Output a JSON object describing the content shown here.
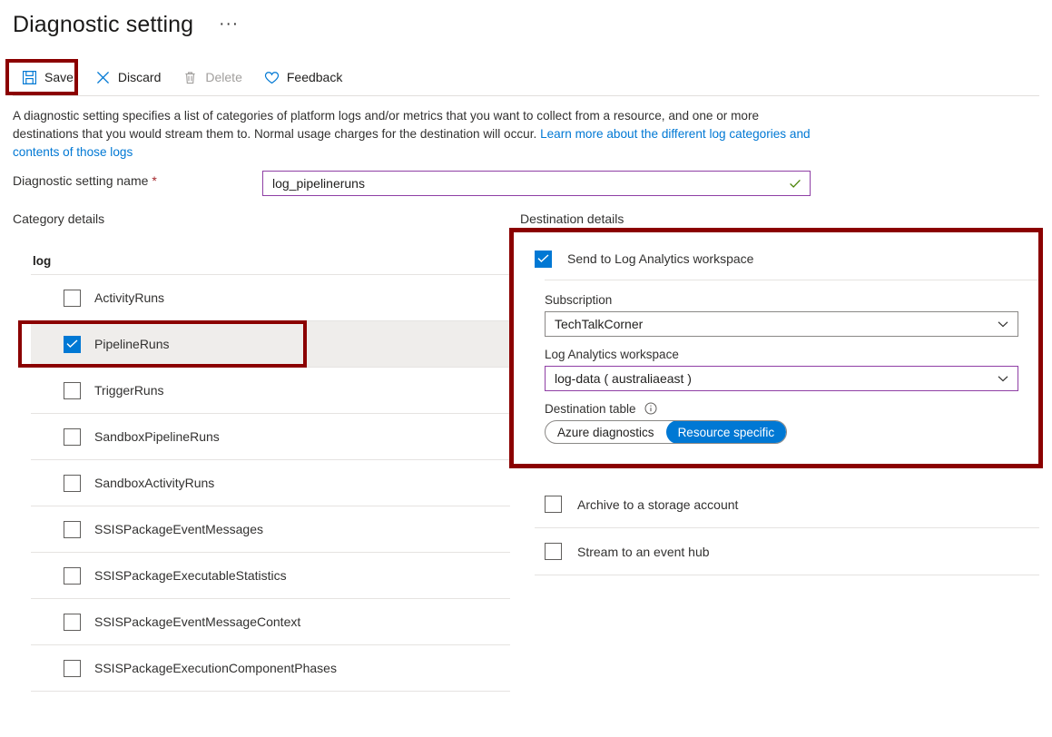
{
  "header": {
    "title": "Diagnostic setting",
    "more_menu": "···"
  },
  "command_bar": {
    "buttons": [
      {
        "label": "Save",
        "icon": "save-icon",
        "enabled": true
      },
      {
        "label": "Discard",
        "icon": "discard-icon",
        "enabled": true
      },
      {
        "label": "Delete",
        "icon": "delete-icon",
        "enabled": false
      },
      {
        "label": "Feedback",
        "icon": "feedback-icon",
        "enabled": true
      }
    ]
  },
  "description": {
    "text_before": "A diagnostic setting specifies a list of categories of platform logs and/or metrics that you want to collect from a resource, and one or more destinations that you would stream them to. Normal usage charges for the destination will occur. ",
    "link_text": "Learn more about the different log categories and contents of those logs"
  },
  "setting_name": {
    "label": "Diagnostic setting name",
    "required_marker": "*",
    "value": "log_pipelineruns",
    "placeholder": "",
    "valid": true
  },
  "category_details": {
    "section_label": "Category details",
    "group_header": "log",
    "items": [
      {
        "label": "ActivityRuns",
        "checked": false,
        "selected": false
      },
      {
        "label": "PipelineRuns",
        "checked": true,
        "selected": true
      },
      {
        "label": "TriggerRuns",
        "checked": false,
        "selected": false
      },
      {
        "label": "SandboxPipelineRuns",
        "checked": false,
        "selected": false
      },
      {
        "label": "SandboxActivityRuns",
        "checked": false,
        "selected": false
      },
      {
        "label": "SSISPackageEventMessages",
        "checked": false,
        "selected": false
      },
      {
        "label": "SSISPackageExecutableStatistics",
        "checked": false,
        "selected": false
      },
      {
        "label": "SSISPackageEventMessageContext",
        "checked": false,
        "selected": false
      },
      {
        "label": "SSISPackageExecutionComponentPhases",
        "checked": false,
        "selected": false
      },
      {
        "label": "",
        "checked": false,
        "selected": false
      }
    ]
  },
  "destination_details": {
    "section_label": "Destination details",
    "log_analytics": {
      "label": "Send to Log Analytics workspace",
      "checked": true,
      "subscription": {
        "label": "Subscription",
        "value": "TechTalkCorner"
      },
      "workspace": {
        "label": "Log Analytics workspace",
        "value": "log-data ( australiaeast )"
      },
      "destination_table": {
        "label": "Destination table",
        "info_icon": "info-icon",
        "options": [
          "Azure diagnostics",
          "Resource specific"
        ],
        "selected": "Resource specific"
      }
    },
    "other_options": [
      {
        "label": "Archive to a storage account",
        "checked": false
      },
      {
        "label": "Stream to an event hub",
        "checked": false
      }
    ]
  },
  "colors": {
    "accent_blue": "#0078d4",
    "annotation_red": "#8b0000",
    "field_accent_purple": "#8f3fa5",
    "required_red": "#a4262c",
    "valid_green": "#498205",
    "row_selected_bg": "#efedeb"
  }
}
